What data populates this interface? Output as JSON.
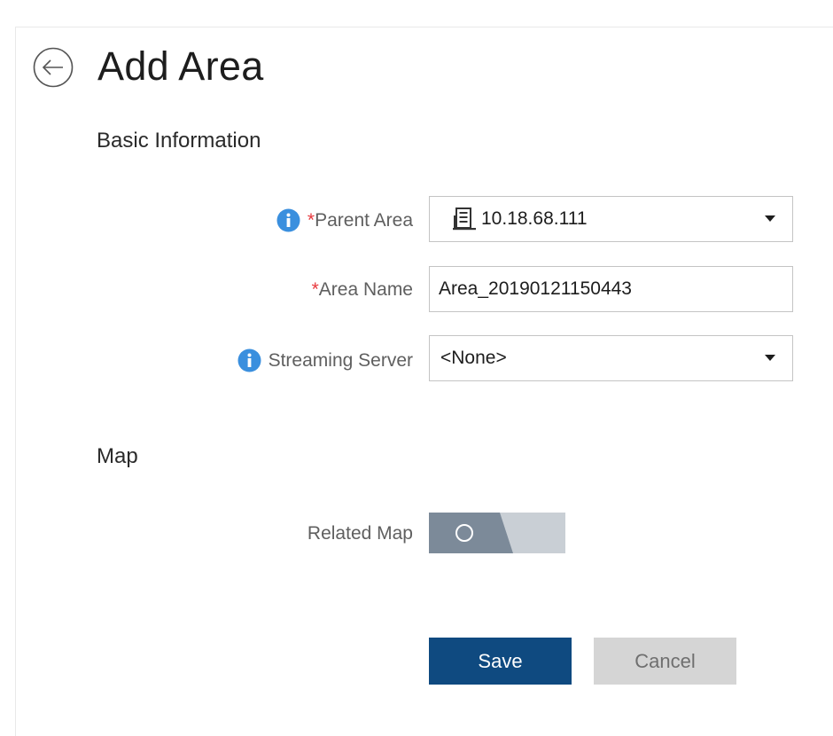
{
  "header": {
    "title": "Add Area",
    "back_icon": "back-arrow-circle-icon"
  },
  "basic_info": {
    "section_title": "Basic Information",
    "parent_area": {
      "required_mark": "*",
      "label": "Parent Area",
      "value": "10.18.68.111",
      "icon": "building-icon"
    },
    "area_name": {
      "required_mark": "*",
      "label": "Area Name",
      "value": "Area_20190121150443"
    },
    "streaming_server": {
      "label": "Streaming Server",
      "value": "<None>"
    }
  },
  "map": {
    "section_title": "Map",
    "related_map": {
      "label": "Related Map",
      "enabled": false
    }
  },
  "actions": {
    "save_label": "Save",
    "cancel_label": "Cancel"
  },
  "colors": {
    "primary": "#0f4a80",
    "info_icon": "#3a8fde",
    "required": "#e8383d",
    "toggle_off_dark": "#7c8a99",
    "toggle_off_light": "#c9cfd5"
  }
}
